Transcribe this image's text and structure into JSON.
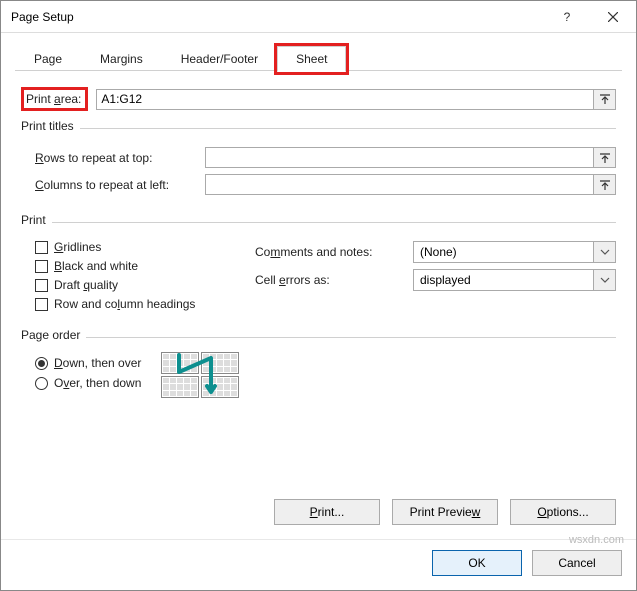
{
  "title": "Page Setup",
  "tabs": {
    "page": "Page",
    "margins": "Margins",
    "headerfooter": "Header/Footer",
    "sheet": "Sheet"
  },
  "printarea": {
    "label_pre": "Print ",
    "label_u": "a",
    "label_post": "rea:",
    "value": "A1:G12"
  },
  "printtitles": {
    "label": "Print titles",
    "rows_u": "R",
    "rows_post": "ows to repeat at top:",
    "rows_value": "",
    "cols_u": "C",
    "cols_post": "olumns to repeat at left:",
    "cols_value": ""
  },
  "print": {
    "label": "Print",
    "gridlines_u": "G",
    "gridlines_post": "ridlines",
    "bw_u": "B",
    "bw_post": "lack and white",
    "draft_pre": "Draft ",
    "draft_u": "q",
    "draft_post": "uality",
    "rowcol_pre": "Row and co",
    "rowcol_u": "l",
    "rowcol_post": "umn headings",
    "comments_pre": "Co",
    "comments_u": "m",
    "comments_post": "ments and notes:",
    "comments_value": "(None)",
    "errors_pre": "Cell ",
    "errors_u": "e",
    "errors_post": "rrors as:",
    "errors_value": "displayed"
  },
  "pageorder": {
    "label": "Page order",
    "down_u": "D",
    "down_post": "own, then over",
    "over_pre": "O",
    "over_u": "v",
    "over_post": "er, then down"
  },
  "buttons": {
    "print_u": "P",
    "print_post": "rint...",
    "preview_pre": "Print Previe",
    "preview_u": "w",
    "options_u": "O",
    "options_post": "ptions...",
    "ok": "OK",
    "cancel": "Cancel"
  },
  "watermark": "wsxdn.com"
}
